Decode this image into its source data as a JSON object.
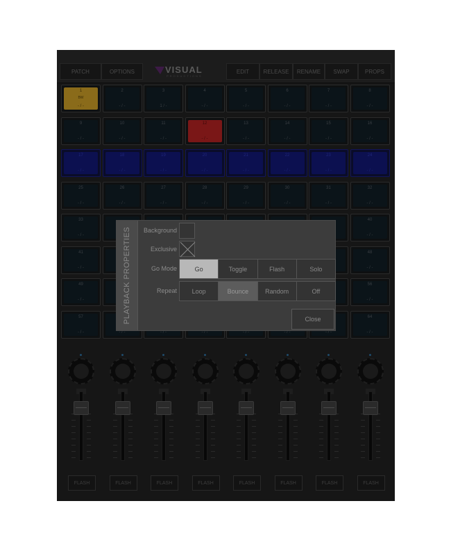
{
  "toolbar": {
    "left": [
      "PATCH",
      "OPTIONS"
    ],
    "right": [
      "EDIT",
      "RELEASE",
      "RENAME",
      "SWAP",
      "PROPS"
    ]
  },
  "logo": {
    "text": "VISUAL",
    "sub": "PRODUCTIONS",
    "accent": "#7a2a8a"
  },
  "grid": {
    "rows": [
      [
        {
          "n": "1",
          "v": "- / -",
          "m": "BW",
          "state": "amber"
        },
        {
          "n": "2",
          "v": "- / -"
        },
        {
          "n": "3",
          "v": "1 / -"
        },
        {
          "n": "4",
          "v": "- / -"
        },
        {
          "n": "5",
          "v": "- / -"
        },
        {
          "n": "6",
          "v": "- / -"
        },
        {
          "n": "7",
          "v": "- / -"
        },
        {
          "n": "8",
          "v": "- / -"
        }
      ],
      [
        {
          "n": "9",
          "v": "- / -"
        },
        {
          "n": "10",
          "v": "- / -"
        },
        {
          "n": "11",
          "v": "- / -"
        },
        {
          "n": "12",
          "v": "- / -",
          "state": "red"
        },
        {
          "n": "13",
          "v": "- / -"
        },
        {
          "n": "14",
          "v": "- / -"
        },
        {
          "n": "15",
          "v": "- / -"
        },
        {
          "n": "16",
          "v": "- / -"
        }
      ],
      [
        {
          "n": "17",
          "v": "- / -",
          "state": "blue"
        },
        {
          "n": "18",
          "v": "- / -",
          "state": "blue"
        },
        {
          "n": "19",
          "v": "- / -",
          "state": "blue"
        },
        {
          "n": "20",
          "v": "- / -",
          "state": "blue"
        },
        {
          "n": "21",
          "v": "- / -",
          "state": "blue"
        },
        {
          "n": "22",
          "v": "- / -",
          "state": "blue"
        },
        {
          "n": "23",
          "v": "- / -",
          "state": "blue"
        },
        {
          "n": "24",
          "v": "- / -",
          "state": "blue"
        }
      ],
      [
        {
          "n": "25",
          "v": "- / -"
        },
        {
          "n": "26",
          "v": "- / -"
        },
        {
          "n": "27",
          "v": "- / -"
        },
        {
          "n": "28",
          "v": "- / -"
        },
        {
          "n": "29",
          "v": "- / -"
        },
        {
          "n": "30",
          "v": "- / -"
        },
        {
          "n": "31",
          "v": "- / -"
        },
        {
          "n": "32",
          "v": "- / -"
        }
      ],
      [
        {
          "n": "33",
          "v": "- / -"
        },
        {
          "n": "",
          "v": ""
        },
        {
          "n": "",
          "v": ""
        },
        {
          "n": "",
          "v": ""
        },
        {
          "n": "",
          "v": ""
        },
        {
          "n": "",
          "v": ""
        },
        {
          "n": "",
          "v": ""
        },
        {
          "n": "40",
          "v": "- / -"
        }
      ],
      [
        {
          "n": "41",
          "v": "- / -"
        },
        {
          "n": "",
          "v": ""
        },
        {
          "n": "",
          "v": ""
        },
        {
          "n": "",
          "v": ""
        },
        {
          "n": "",
          "v": ""
        },
        {
          "n": "",
          "v": ""
        },
        {
          "n": "",
          "v": ""
        },
        {
          "n": "48",
          "v": "- / -"
        }
      ],
      [
        {
          "n": "49",
          "v": "- / -"
        },
        {
          "n": "",
          "v": ""
        },
        {
          "n": "",
          "v": ""
        },
        {
          "n": "",
          "v": ""
        },
        {
          "n": "",
          "v": ""
        },
        {
          "n": "",
          "v": ""
        },
        {
          "n": "",
          "v": ""
        },
        {
          "n": "56",
          "v": "- / -"
        }
      ],
      [
        {
          "n": "57",
          "v": "- / -"
        },
        {
          "n": "",
          "v": "- / -"
        },
        {
          "n": "",
          "v": "- / -"
        },
        {
          "n": "",
          "v": "- / -"
        },
        {
          "n": "",
          "v": "- / -"
        },
        {
          "n": "",
          "v": "- / -"
        },
        {
          "n": "",
          "v": "- / -"
        },
        {
          "n": "64",
          "v": "- / -"
        }
      ]
    ]
  },
  "faders": {
    "count": 8,
    "flash_label": "FLASH"
  },
  "dialog": {
    "title": "PLAYBACK PROPERTIES",
    "background_label": "Background",
    "exclusive_label": "Exclusive",
    "exclusive_checked": true,
    "gomode_label": "Go Mode",
    "gomode_options": [
      "Go",
      "Toggle",
      "Flash",
      "Solo"
    ],
    "gomode_selected": "Go",
    "repeat_label": "Repeat",
    "repeat_options": [
      "Loop",
      "Bounce",
      "Random",
      "Off"
    ],
    "repeat_selected": "Bounce",
    "close_label": "Close"
  },
  "colors": {
    "amber": "#8a6b1a",
    "red": "#7a1717",
    "blue": "#0c1050"
  }
}
